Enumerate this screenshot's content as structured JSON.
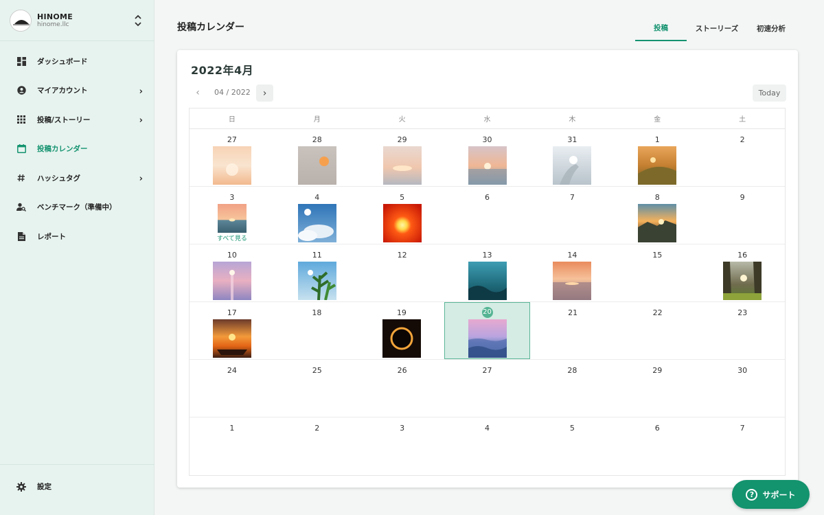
{
  "account": {
    "name": "HINOME",
    "handle": "hinome.llc"
  },
  "nav": [
    {
      "label": "ダッシュボード",
      "icon": "dashboard-icon",
      "chevron": false,
      "active": false
    },
    {
      "label": "マイアカウント",
      "icon": "account-circle-icon",
      "chevron": true,
      "active": false
    },
    {
      "label": "投稿/ストーリー",
      "icon": "grid-apps-icon",
      "chevron": true,
      "active": false
    },
    {
      "label": "投稿カレンダー",
      "icon": "calendar-icon",
      "chevron": false,
      "active": true
    },
    {
      "label": "ハッシュタグ",
      "icon": "hashtag-icon",
      "chevron": true,
      "active": false
    },
    {
      "label": "ベンチマーク（準備中）",
      "icon": "person-search-icon",
      "chevron": false,
      "active": false
    },
    {
      "label": "レポート",
      "icon": "document-icon",
      "chevron": false,
      "active": false
    }
  ],
  "settings_label": "設定",
  "page_title": "投稿カレンダー",
  "tabs": [
    {
      "label": "投稿",
      "active": true
    },
    {
      "label": "ストーリーズ",
      "active": false
    },
    {
      "label": "初速分析",
      "active": false
    }
  ],
  "calendar": {
    "month_title": "2022年4月",
    "nav_date": "04 / 2022",
    "today_label": "Today",
    "weekdays": [
      "日",
      "月",
      "火",
      "水",
      "木",
      "金",
      "土"
    ],
    "see_all_label": "すべて見る",
    "selected_day": "20",
    "weeks": [
      [
        {
          "day": "27",
          "photo": "peach-sunset"
        },
        {
          "day": "28",
          "photo": "gray-sun"
        },
        {
          "day": "29",
          "photo": "pink-horizon"
        },
        {
          "day": "30",
          "photo": "sea-sunset"
        },
        {
          "day": "31",
          "photo": "hand-sun"
        },
        {
          "day": "1",
          "photo": "golden-hill"
        },
        {
          "day": "2",
          "photo": null
        }
      ],
      [
        {
          "day": "3",
          "photo": "sea-dusk",
          "see_all": true
        },
        {
          "day": "4",
          "photo": "blue-sky-clouds"
        },
        {
          "day": "5",
          "photo": "red-sun"
        },
        {
          "day": "6",
          "photo": null
        },
        {
          "day": "7",
          "photo": null
        },
        {
          "day": "8",
          "photo": "mountain-sunset"
        },
        {
          "day": "9",
          "photo": null
        }
      ],
      [
        {
          "day": "10",
          "photo": "purple-sea"
        },
        {
          "day": "11",
          "photo": "plant-sky"
        },
        {
          "day": "12",
          "photo": null
        },
        {
          "day": "13",
          "photo": "underwater"
        },
        {
          "day": "14",
          "photo": "beach-sunset"
        },
        {
          "day": "15",
          "photo": null
        },
        {
          "day": "16",
          "photo": "forest-sun"
        }
      ],
      [
        {
          "day": "17",
          "photo": "boat-sunset"
        },
        {
          "day": "18",
          "photo": null
        },
        {
          "day": "19",
          "photo": "eclipse"
        },
        {
          "day": "20",
          "photo": "waves-pastel",
          "selected": true
        },
        {
          "day": "21",
          "photo": null
        },
        {
          "day": "22",
          "photo": null
        },
        {
          "day": "23",
          "photo": null
        }
      ],
      [
        {
          "day": "24",
          "photo": null
        },
        {
          "day": "25",
          "photo": null
        },
        {
          "day": "26",
          "photo": null
        },
        {
          "day": "27",
          "photo": null
        },
        {
          "day": "28",
          "photo": null
        },
        {
          "day": "29",
          "photo": null
        },
        {
          "day": "30",
          "photo": null
        }
      ],
      [
        {
          "day": "1",
          "photo": null
        },
        {
          "day": "2",
          "photo": null
        },
        {
          "day": "3",
          "photo": null
        },
        {
          "day": "4",
          "photo": null
        },
        {
          "day": "5",
          "photo": null
        },
        {
          "day": "6",
          "photo": null
        },
        {
          "day": "7",
          "photo": null
        }
      ]
    ]
  },
  "support_label": "サポート",
  "colors": {
    "accent": "#14936f",
    "sidebar_bg": "#e7f3ef",
    "selected_bg": "#d4ece4"
  }
}
